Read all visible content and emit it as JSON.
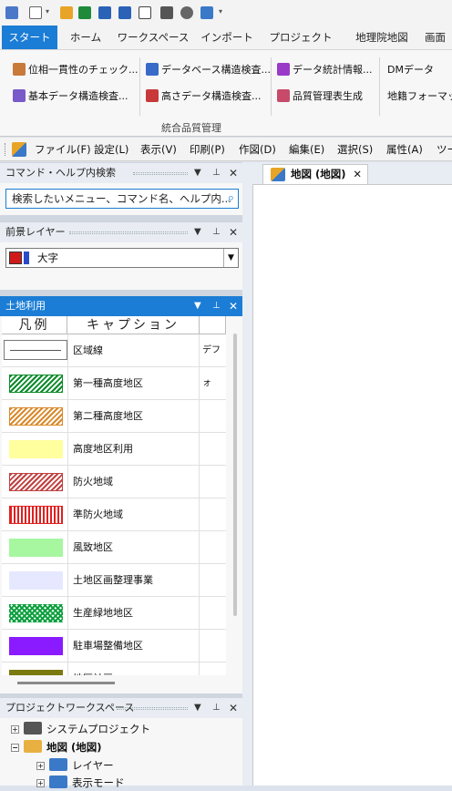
{
  "ribbon_tabs": [
    "スタート",
    "ホーム",
    "ワークスペース",
    "インポート",
    "プロジェクト",
    "地理院地図",
    "画面"
  ],
  "ribbon": {
    "buttons": [
      "位相一貫性のチェック...",
      "基本データ構造検査...",
      "データベース構造検査...",
      "高さデータ構造検査...",
      "データ統計情報...",
      "品質管理表生成",
      "DMデータ",
      "地籍フォーマット"
    ],
    "group_label": "統合品質管理"
  },
  "menus": [
    "ファイル(F)",
    "設定(L)",
    "表示(V)",
    "印刷(P)",
    "作図(D)",
    "編集(E)",
    "選択(S)",
    "属性(A)",
    "ツー"
  ],
  "command_panel": {
    "title": "コマンド・ヘルプ内検索",
    "search_placeholder": "検索したいメニュー、コマンド名、ヘルプ内..."
  },
  "foreground_panel": {
    "title": "前景レイヤー",
    "selected_layer": "大字"
  },
  "landuse_panel": {
    "title": "土地利用",
    "columns": [
      "凡例",
      "キャプション",
      ""
    ],
    "rows": [
      {
        "caption": "区域線",
        "extra": "デフォ",
        "swatch": "line",
        "color": "#555555"
      },
      {
        "caption": "第一種高度地区",
        "swatch": "hatch",
        "color": "#0a8a2a"
      },
      {
        "caption": "第二種高度地区",
        "swatch": "hatch",
        "color": "#d9892a"
      },
      {
        "caption": "高度地区利用",
        "swatch": "solid",
        "color": "#ffff9e"
      },
      {
        "caption": "防火地域",
        "swatch": "hatch",
        "color": "#c04040"
      },
      {
        "caption": "準防火地域",
        "swatch": "vstripe",
        "color": "#e02020"
      },
      {
        "caption": "風致地区",
        "swatch": "solid",
        "color": "#a6f7a0"
      },
      {
        "caption": "土地区画整理事業",
        "swatch": "solid",
        "color": "#e6e8ff"
      },
      {
        "caption": "生産緑地地区",
        "swatch": "cross",
        "color": "#0fa040"
      },
      {
        "caption": "駐車場整備地区",
        "swatch": "solid",
        "color": "#8a1aff"
      },
      {
        "caption": "地区計画",
        "swatch": "solid",
        "color": "#7a7a10"
      }
    ]
  },
  "project_panel": {
    "title": "プロジェクトワークスペース",
    "items": [
      "システムプロジェクト",
      "地図 (地図)",
      "レイヤー",
      "表示モード"
    ]
  },
  "document": {
    "tab_label": "地図 (地図)"
  },
  "colors": {
    "accent": "#1b7dd5",
    "panel_bg": "#f7f7f7"
  }
}
